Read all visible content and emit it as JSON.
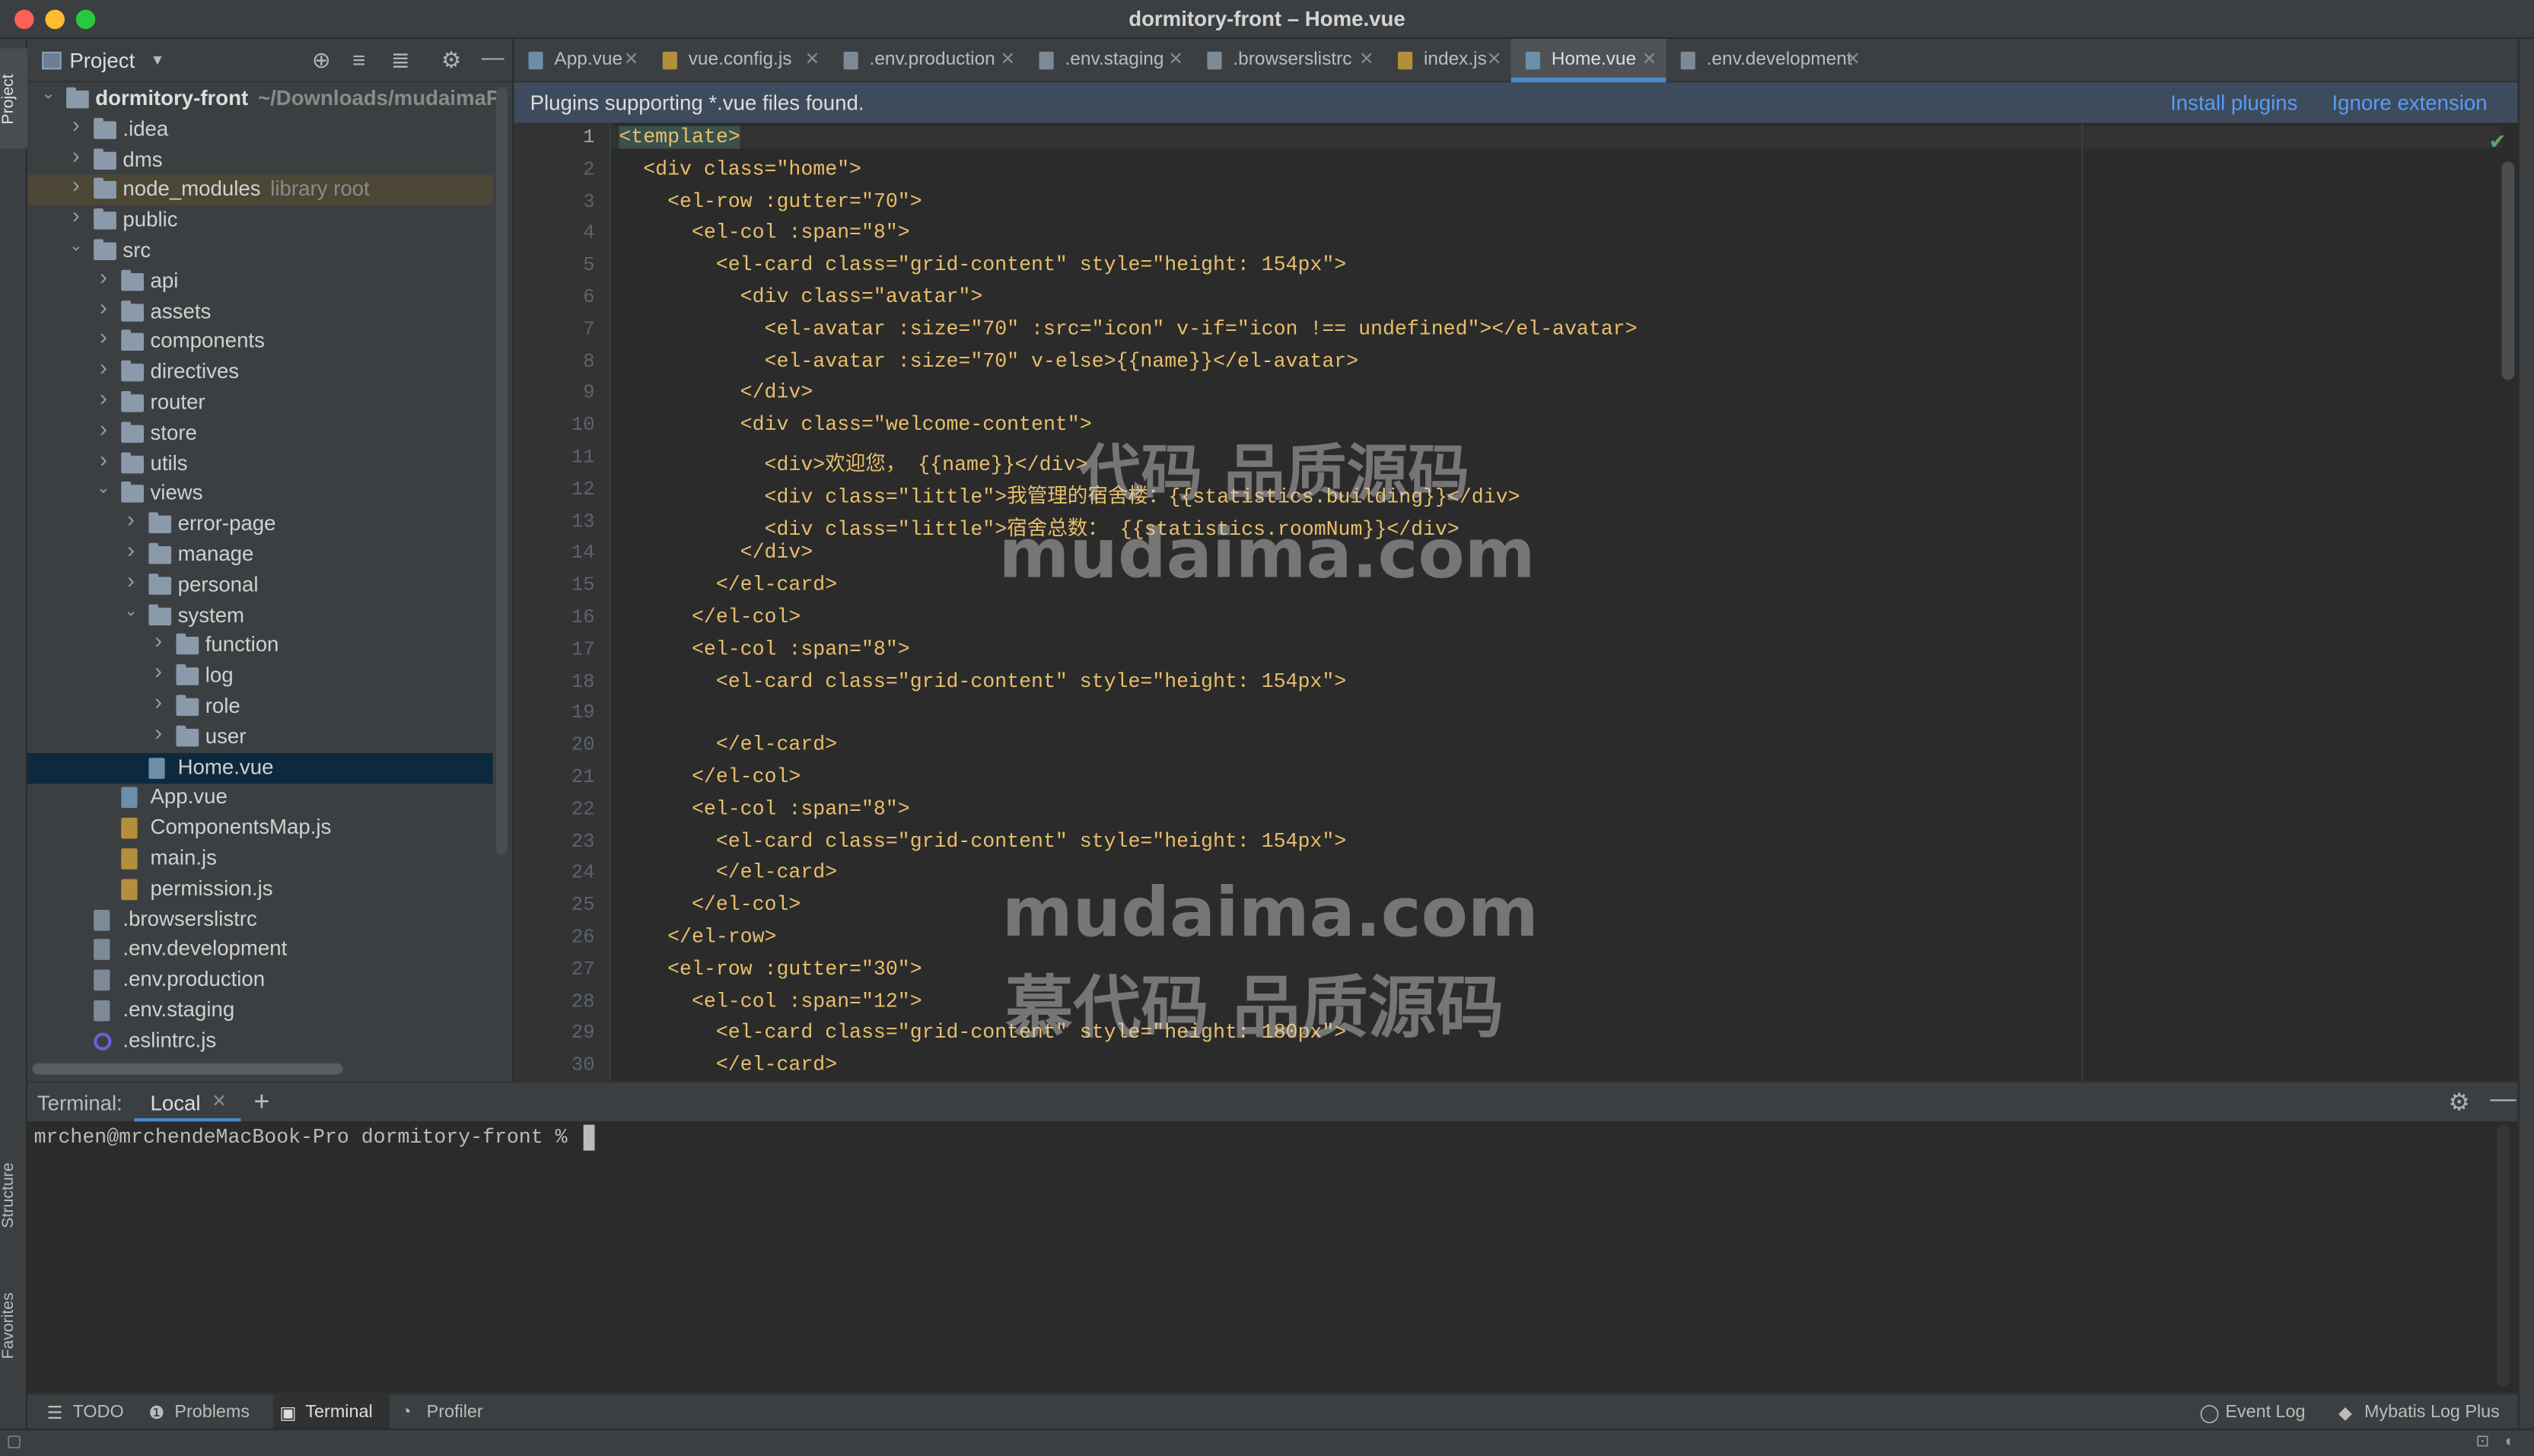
{
  "window": {
    "title": "dormitory-front – Home.vue"
  },
  "left_strip": {
    "project": "Project",
    "structure": "Structure",
    "favorites": "Favorites"
  },
  "project_panel": {
    "title": "Project",
    "tree": [
      {
        "label": "dormitory-front",
        "extra": "~/Downloads/mudaimaP",
        "depth": 0,
        "type": "root",
        "expanded": true
      },
      {
        "label": ".idea",
        "depth": 1,
        "type": "folder",
        "expanded": false
      },
      {
        "label": "dms",
        "depth": 1,
        "type": "folder",
        "expanded": false
      },
      {
        "label": "node_modules",
        "extra": "library root",
        "depth": 1,
        "type": "folder",
        "expanded": false,
        "highlight": true
      },
      {
        "label": "public",
        "depth": 1,
        "type": "folder",
        "expanded": false
      },
      {
        "label": "src",
        "depth": 1,
        "type": "folder",
        "expanded": true
      },
      {
        "label": "api",
        "depth": 2,
        "type": "folder",
        "expanded": false
      },
      {
        "label": "assets",
        "depth": 2,
        "type": "folder",
        "expanded": false
      },
      {
        "label": "components",
        "depth": 2,
        "type": "folder",
        "expanded": false
      },
      {
        "label": "directives",
        "depth": 2,
        "type": "folder",
        "expanded": false
      },
      {
        "label": "router",
        "depth": 2,
        "type": "folder",
        "expanded": false
      },
      {
        "label": "store",
        "depth": 2,
        "type": "folder",
        "expanded": false
      },
      {
        "label": "utils",
        "depth": 2,
        "type": "folder",
        "expanded": false
      },
      {
        "label": "views",
        "depth": 2,
        "type": "folder",
        "expanded": true
      },
      {
        "label": "error-page",
        "depth": 3,
        "type": "folder",
        "expanded": false
      },
      {
        "label": "manage",
        "depth": 3,
        "type": "folder",
        "expanded": false
      },
      {
        "label": "personal",
        "depth": 3,
        "type": "folder",
        "expanded": false
      },
      {
        "label": "system",
        "depth": 3,
        "type": "folder",
        "expanded": true
      },
      {
        "label": "function",
        "depth": 4,
        "type": "folder",
        "expanded": false
      },
      {
        "label": "log",
        "depth": 4,
        "type": "folder",
        "expanded": false
      },
      {
        "label": "role",
        "depth": 4,
        "type": "folder",
        "expanded": false
      },
      {
        "label": "user",
        "depth": 4,
        "type": "folder",
        "expanded": false
      },
      {
        "label": "Home.vue",
        "depth": 3,
        "type": "vue",
        "selected": true
      },
      {
        "label": "App.vue",
        "depth": 2,
        "type": "vue"
      },
      {
        "label": "ComponentsMap.js",
        "depth": 2,
        "type": "js"
      },
      {
        "label": "main.js",
        "depth": 2,
        "type": "js"
      },
      {
        "label": "permission.js",
        "depth": 2,
        "type": "js"
      },
      {
        "label": ".browserslistrc",
        "depth": 1,
        "type": "file"
      },
      {
        "label": ".env.development",
        "depth": 1,
        "type": "file"
      },
      {
        "label": ".env.production",
        "depth": 1,
        "type": "file"
      },
      {
        "label": ".env.staging",
        "depth": 1,
        "type": "file"
      },
      {
        "label": ".eslintrc.js",
        "depth": 1,
        "type": "eslint"
      }
    ]
  },
  "tabs": [
    {
      "label": "App.vue",
      "type": "vue"
    },
    {
      "label": "vue.config.js",
      "type": "js"
    },
    {
      "label": ".env.production",
      "type": "file"
    },
    {
      "label": ".env.staging",
      "type": "file"
    },
    {
      "label": ".browserslistrc",
      "type": "file"
    },
    {
      "label": "index.js",
      "type": "js"
    },
    {
      "label": "Home.vue",
      "type": "vue",
      "active": true
    },
    {
      "label": ".env.development",
      "type": "file"
    }
  ],
  "plugin_bar": {
    "message": "Plugins supporting *.vue files found.",
    "install": "Install plugins",
    "ignore": "Ignore extension"
  },
  "code_lines": [
    "<template>",
    "  <div class=\"home\">",
    "    <el-row :gutter=\"70\">",
    "      <el-col :span=\"8\">",
    "        <el-card class=\"grid-content\" style=\"height: 154px\">",
    "          <div class=\"avatar\">",
    "            <el-avatar :size=\"70\" :src=\"icon\" v-if=\"icon !== undefined\"></el-avatar>",
    "            <el-avatar :size=\"70\" v-else>{{name}}</el-avatar>",
    "          </div>",
    "          <div class=\"welcome-content\">",
    "            <div>欢迎您， {{name}}</div>",
    "            <div class=\"little\">我管理的宿舍楼：{{statistics.building}}</div>",
    "            <div class=\"little\">宿舍总数： {{statistics.roomNum}}</div>",
    "          </div>",
    "        </el-card>",
    "      </el-col>",
    "      <el-col :span=\"8\">",
    "        <el-card class=\"grid-content\" style=\"height: 154px\">",
    "",
    "        </el-card>",
    "      </el-col>",
    "      <el-col :span=\"8\">",
    "        <el-card class=\"grid-content\" style=\"height: 154px\">",
    "        </el-card>",
    "      </el-col>",
    "    </el-row>",
    "    <el-row :gutter=\"30\">",
    "      <el-col :span=\"12\">",
    "        <el-card class=\"grid-content\" style=\"height: 180px\">",
    "        </el-card>"
  ],
  "watermark": {
    "top_cn": "代码 品质源码",
    "top_en": "mudaima.com",
    "bottom_en": "mudaima.com",
    "bottom_cn": "慕代码 品质源码"
  },
  "terminal": {
    "title": "Terminal:",
    "tab": "Local",
    "prompt": "mrchen@mrchendeMacBook-Pro dormitory-front % "
  },
  "bottom_tools": {
    "todo": "TODO",
    "problems": "Problems",
    "terminal": "Terminal",
    "profiler": "Profiler",
    "event_log": "Event Log",
    "mybatis": "Mybatis Log Plus"
  }
}
